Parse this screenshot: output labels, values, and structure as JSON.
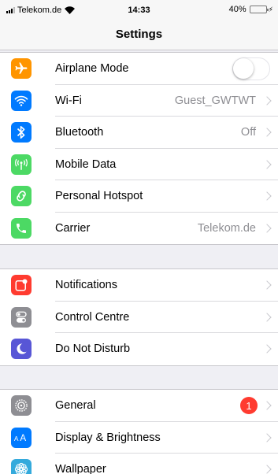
{
  "status_bar": {
    "carrier": "Telekom.de",
    "time": "14:33",
    "battery": "40%",
    "battery_level": 0.4
  },
  "nav": {
    "title": "Settings"
  },
  "groups": [
    [
      {
        "label": "Airplane Mode",
        "value": "",
        "icon": "airplane-icon",
        "color": "#ff9500",
        "control": "toggle",
        "toggle_on": false
      },
      {
        "label": "Wi-Fi",
        "value": "Guest_GWTWT",
        "icon": "wifi-icon",
        "color": "#007aff",
        "control": "chevron"
      },
      {
        "label": "Bluetooth",
        "value": "Off",
        "icon": "bluetooth-icon",
        "color": "#007aff",
        "control": "chevron"
      },
      {
        "label": "Mobile Data",
        "value": "",
        "icon": "antenna-icon",
        "color": "#4cd964",
        "control": "chevron"
      },
      {
        "label": "Personal Hotspot",
        "value": "",
        "icon": "hotspot-icon",
        "color": "#4cd964",
        "control": "chevron"
      },
      {
        "label": "Carrier",
        "value": "Telekom.de",
        "icon": "phone-icon",
        "color": "#4cd964",
        "control": "chevron"
      }
    ],
    [
      {
        "label": "Notifications",
        "value": "",
        "icon": "notifications-icon",
        "color": "#ff3b30",
        "control": "chevron"
      },
      {
        "label": "Control Centre",
        "value": "",
        "icon": "control-centre-icon",
        "color": "#8e8e93",
        "control": "chevron"
      },
      {
        "label": "Do Not Disturb",
        "value": "",
        "icon": "moon-icon",
        "color": "#5856d6",
        "control": "chevron"
      }
    ],
    [
      {
        "label": "General",
        "value": "",
        "badge": "1",
        "icon": "gear-icon",
        "color": "#8e8e93",
        "control": "chevron"
      },
      {
        "label": "Display & Brightness",
        "value": "",
        "icon": "display-icon",
        "color": "#007aff",
        "control": "chevron"
      },
      {
        "label": "Wallpaper",
        "value": "",
        "icon": "wallpaper-icon",
        "color": "#34aadc",
        "control": "chevron"
      }
    ]
  ]
}
